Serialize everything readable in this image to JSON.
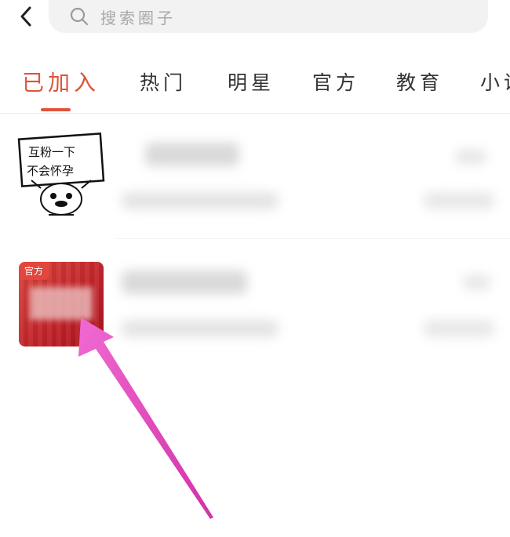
{
  "header": {
    "search_placeholder": "搜索圈子"
  },
  "tabs": [
    {
      "label": "已加入",
      "active": true
    },
    {
      "label": "热门",
      "active": false
    },
    {
      "label": "明星",
      "active": false
    },
    {
      "label": "官方",
      "active": false
    },
    {
      "label": "教育",
      "active": false
    },
    {
      "label": "小说",
      "active": false
    }
  ],
  "list": [
    {
      "thumb_text_line1": "互粉一下",
      "thumb_text_line2": "不会怀孕"
    },
    {
      "badge": "官方"
    }
  ],
  "colors": {
    "accent": "#e0543a",
    "arrow": "#e040b8",
    "official_bg": "#c2252b"
  },
  "icons": [
    "back-chevron-icon",
    "search-icon"
  ]
}
